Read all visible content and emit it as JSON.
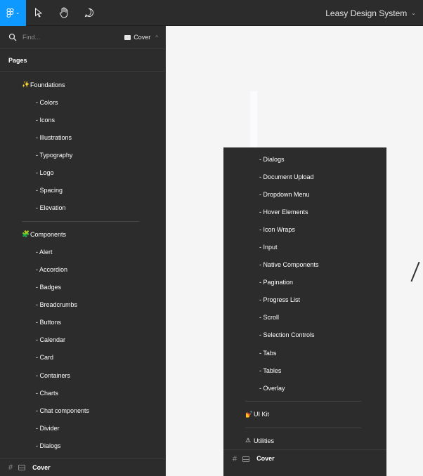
{
  "toolbar": {
    "file_title": "Leasy Design System",
    "tools": [
      "figma-menu",
      "move",
      "hand",
      "comment"
    ]
  },
  "search": {
    "placeholder": "Find...",
    "current_page": "Cover"
  },
  "pages_panel": {
    "header": "Pages",
    "items": [
      {
        "kind": "section",
        "icon": "✨",
        "label": "Foundations"
      },
      {
        "kind": "child",
        "label": "- Colors"
      },
      {
        "kind": "child",
        "label": "- Icons"
      },
      {
        "kind": "child",
        "label": "- Illustrations"
      },
      {
        "kind": "child",
        "label": "- Typography"
      },
      {
        "kind": "child",
        "label": "- Logo"
      },
      {
        "kind": "child",
        "label": "- Spacing"
      },
      {
        "kind": "child",
        "label": "- Elevation"
      },
      {
        "kind": "divider"
      },
      {
        "kind": "section",
        "icon": "🧩",
        "label": "Components"
      },
      {
        "kind": "child",
        "label": "- Alert"
      },
      {
        "kind": "child",
        "label": "- Accordion"
      },
      {
        "kind": "child",
        "label": "- Badges"
      },
      {
        "kind": "child",
        "label": "- Breadcrumbs"
      },
      {
        "kind": "child",
        "label": "- Buttons"
      },
      {
        "kind": "child",
        "label": "- Calendar"
      },
      {
        "kind": "child",
        "label": "- Card"
      },
      {
        "kind": "child",
        "label": "- Containers"
      },
      {
        "kind": "child",
        "label": "- Charts"
      },
      {
        "kind": "child",
        "label": "- Chat components"
      },
      {
        "kind": "child",
        "label": "- Divider"
      },
      {
        "kind": "child",
        "label": "- Dialogs"
      }
    ],
    "bottom_label": "Cover"
  },
  "dropdown": {
    "items": [
      {
        "kind": "child",
        "label": "- Dialogs"
      },
      {
        "kind": "child",
        "label": "- Document Upload"
      },
      {
        "kind": "child",
        "label": "- Dropdown Menu"
      },
      {
        "kind": "child",
        "label": "- Hover Elements"
      },
      {
        "kind": "child",
        "label": "- Icon Wraps"
      },
      {
        "kind": "child",
        "label": "- Input"
      },
      {
        "kind": "child",
        "label": "- Native Components"
      },
      {
        "kind": "child",
        "label": "- Pagination"
      },
      {
        "kind": "child",
        "label": "- Progress List"
      },
      {
        "kind": "child",
        "label": "- Scroll"
      },
      {
        "kind": "child",
        "label": "- Selection Controls"
      },
      {
        "kind": "child",
        "label": "- Tabs"
      },
      {
        "kind": "child",
        "label": "- Tables"
      },
      {
        "kind": "child",
        "label": "- Overlay"
      },
      {
        "kind": "divider"
      },
      {
        "kind": "section",
        "icon": "💅",
        "label": "UI Kit"
      },
      {
        "kind": "divider"
      },
      {
        "kind": "section",
        "icon": "⚠",
        "label": "Utilities"
      }
    ],
    "bottom_label": "Cover"
  },
  "colors": {
    "toolbar_bg": "#2c2c2c",
    "active_tool": "#0d99ff",
    "panel_bg": "#2c2c2c",
    "canvas_bg": "#f5f5f5"
  }
}
